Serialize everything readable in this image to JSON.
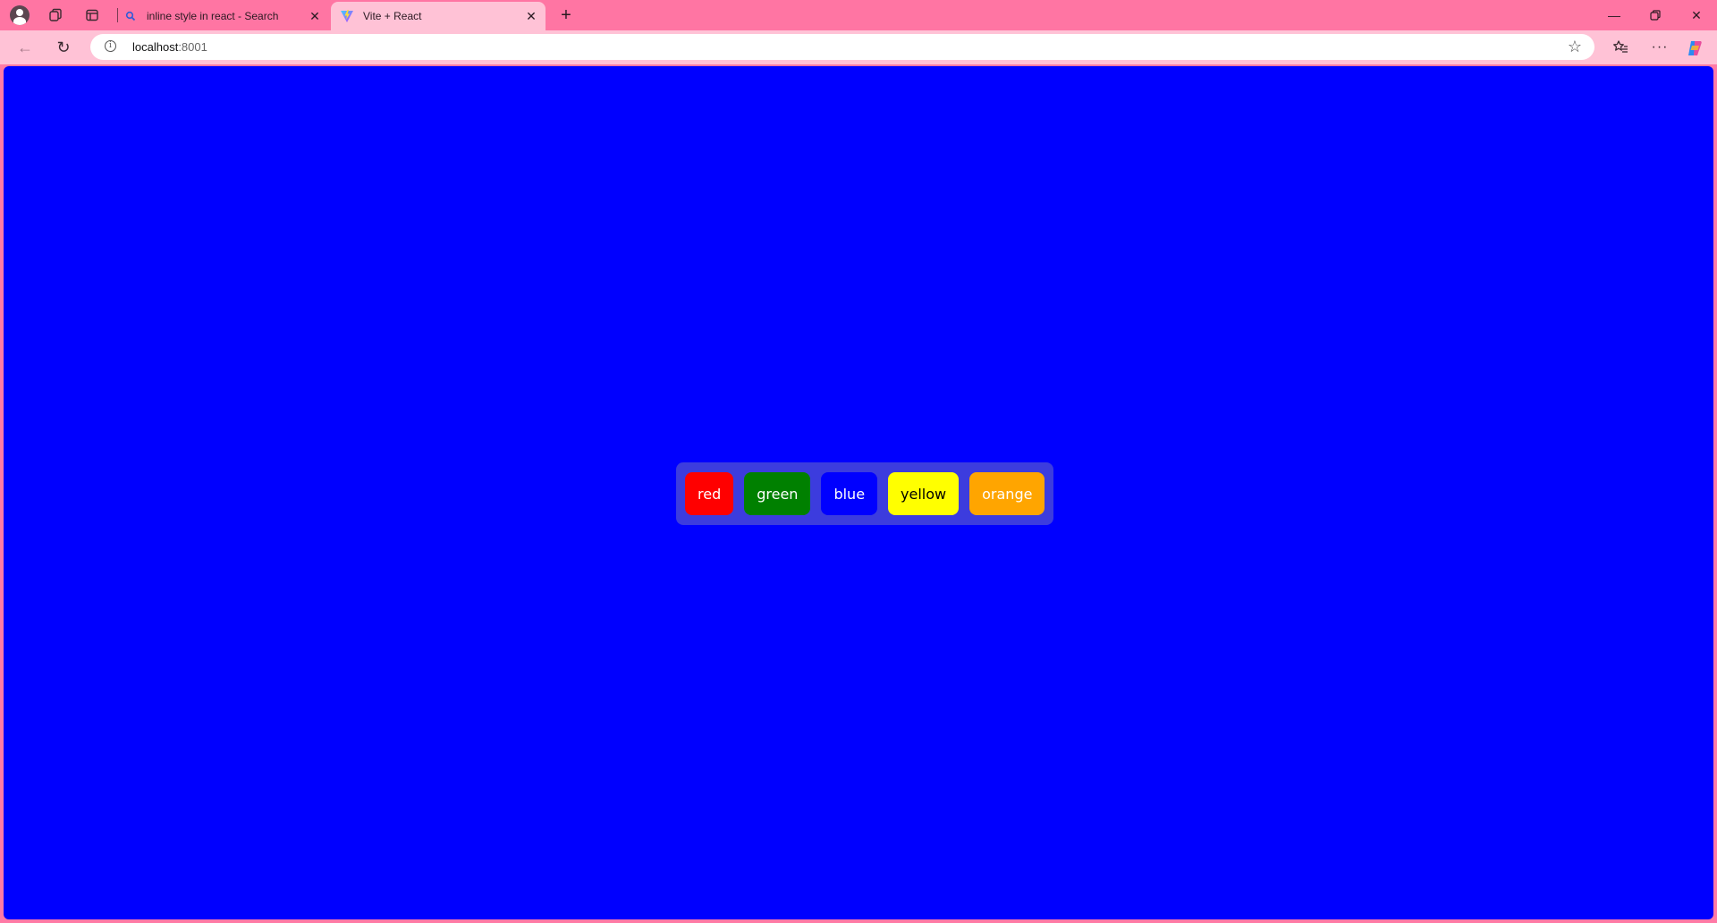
{
  "browser": {
    "tabs": [
      {
        "title": "inline style in react - Search",
        "favicon": "search-icon",
        "active": false
      },
      {
        "title": "Vite + React",
        "favicon": "vite-icon",
        "active": true
      }
    ],
    "url": {
      "host": "localhost",
      "port": ":8001"
    }
  },
  "page": {
    "background": "#0000ff",
    "group_background": "#3c3cde",
    "buttons": [
      {
        "label": "red",
        "color": "#ff0000",
        "text_color": "#ffffff"
      },
      {
        "label": "green",
        "color": "#008000",
        "text_color": "#ffffff"
      },
      {
        "label": "blue",
        "color": "#0000ff",
        "text_color": "#ffffff"
      },
      {
        "label": "yellow",
        "color": "#ffff00",
        "text_color": "#000000"
      },
      {
        "label": "orange",
        "color": "#ffa500",
        "text_color": "#ffffff"
      }
    ]
  }
}
